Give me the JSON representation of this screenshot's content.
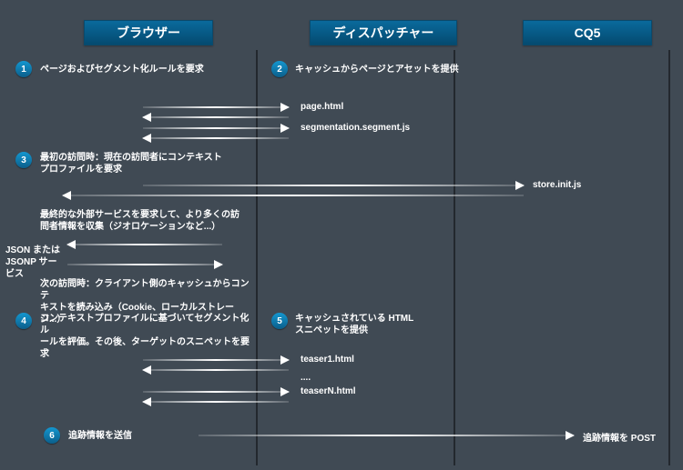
{
  "columns": {
    "browser": "ブラウザー",
    "dispatcher": "ディスパッチャー",
    "cq5": "CQ5"
  },
  "steps": {
    "s1": "ページおよびセグメント化ルールを要求",
    "s2": "キャッシュからページとアセットを提供",
    "s3": "最初の訪問時：現在の訪問者にコンテキスト\nプロファイルを要求",
    "s3b": "最終的な外部サービスを要求して、より多くの訪\n問者情報を収集（ジオロケーションなど...）",
    "s3c": "次の訪問時：クライアント側のキャッシュからコンテ\nキストを読み込み（Cookie、ローカルストレージ...）",
    "s4": "コンテキストプロファイルに基づいてセグメント化ル\nールを評価。その後、ターゲットのスニペットを要求",
    "s5": "キャッシュされている HTML\nスニペットを提供",
    "s6": "追跡情報を送信"
  },
  "side": {
    "jsonp": "JSON または\nJSONP サービス"
  },
  "messages": {
    "page_html": "page.html",
    "segmentation": "segmentation.segment.js",
    "store_init": "store.init.js",
    "teaser1": "teaser1.html",
    "dots": "....",
    "teaserN": "teaserN.html",
    "track_post": "追跡情報を POST"
  }
}
